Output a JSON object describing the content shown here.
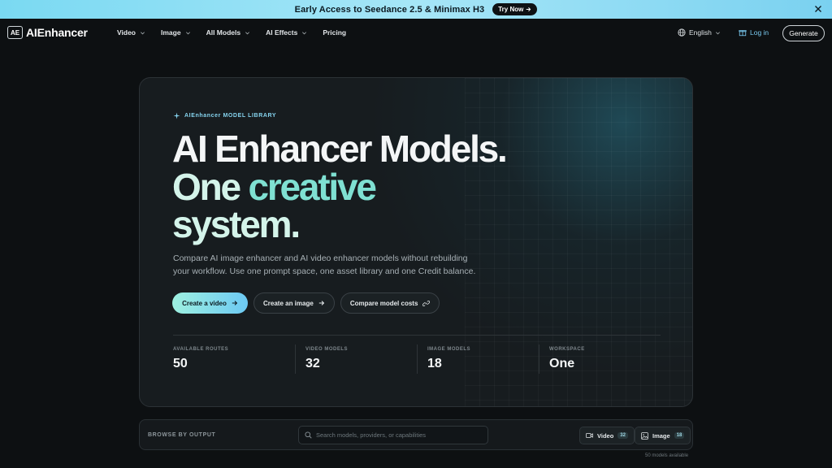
{
  "banner": {
    "text": "Early Access to Seedance 2.5 & Minimax H3",
    "cta_label": "Try Now"
  },
  "nav": {
    "logo_mark": "AE",
    "brand": "AIEnhancer",
    "items": [
      {
        "label": "Video"
      },
      {
        "label": "Image"
      },
      {
        "label": "All Models"
      },
      {
        "label": "AI Effects"
      },
      {
        "label": "Pricing"
      }
    ],
    "language": "English",
    "login": "Log in",
    "generate": "Generate"
  },
  "hero": {
    "eyebrow": "AIEnhancer MODEL LIBRARY",
    "title_line1": "AI Enhancer Models.",
    "title_line2_a": "One ",
    "title_line2_b": "creative",
    "title_line3": "system.",
    "description": "Compare AI image enhancer and AI video enhancer models without rebuilding your workflow. Use one prompt space, one asset library and one Credit balance.",
    "buttons": {
      "create_video": "Create a video",
      "create_image": "Create an image",
      "compare_costs": "Compare model costs"
    },
    "stats": [
      {
        "label": "AVAILABLE ROUTES",
        "value": "50"
      },
      {
        "label": "VIDEO MODELS",
        "value": "32"
      },
      {
        "label": "IMAGE MODELS",
        "value": "18"
      },
      {
        "label": "WORKSPACE",
        "value": "One"
      }
    ]
  },
  "browse": {
    "label": "BROWSE BY OUTPUT",
    "search_placeholder": "Search models, providers, or capabilities",
    "search_value": "",
    "filters": [
      {
        "label": "Video",
        "count": "32"
      },
      {
        "label": "Image",
        "count": "18"
      }
    ],
    "models_available": "50 models available"
  },
  "colors": {
    "accent_cyan": "#79c9ef",
    "accent_mint": "#7fe0d2",
    "background": "#0d1012"
  }
}
